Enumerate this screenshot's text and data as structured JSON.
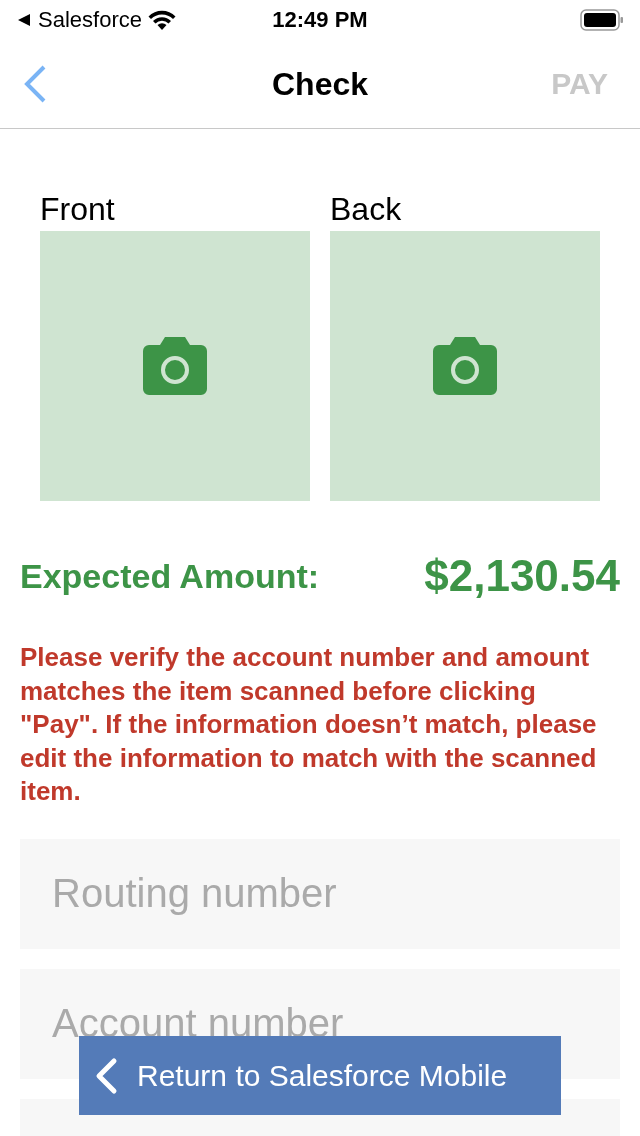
{
  "status_bar": {
    "back_app": "Salesforce",
    "time": "12:49 PM"
  },
  "nav": {
    "title": "Check",
    "pay_button": {
      "label": "PAY",
      "disabled": true
    }
  },
  "photos": [
    {
      "label": "Front"
    },
    {
      "label": "Back"
    }
  ],
  "amount": {
    "label": "Expected Amount:",
    "value": "$2,130.54"
  },
  "warning": "Please verify the account number and amount matches the item scanned before clicking \"Pay\". If the information doesn’t match, please edit the information to match with the scanned item.",
  "fields": [
    {
      "kind": "text",
      "placeholder": "Routing number"
    },
    {
      "kind": "text",
      "placeholder": "Account number"
    },
    {
      "kind": "blank"
    }
  ],
  "return_button": {
    "label": "Return to Salesforce Mobile"
  }
}
